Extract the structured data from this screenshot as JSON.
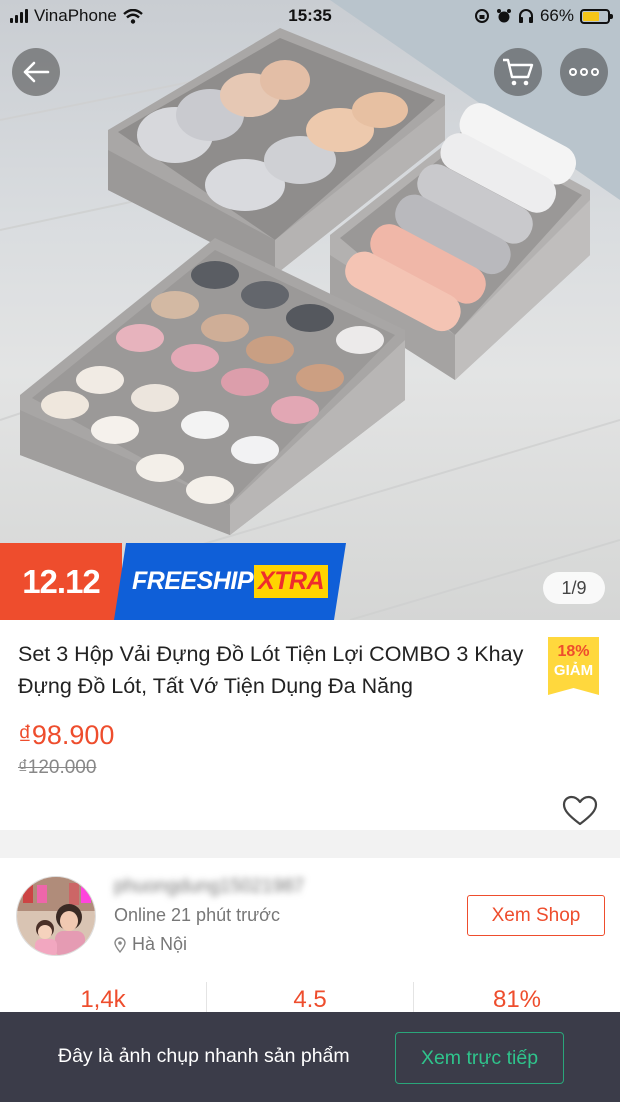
{
  "status_bar": {
    "carrier": "VinaPhone",
    "time": "15:35",
    "battery_percent": "66%",
    "battery_level": 0.66,
    "battery_color": "#f5c518",
    "icons": [
      "signal-icon",
      "wifi-icon",
      "rotation-lock-icon",
      "alarm-icon",
      "headphones-icon",
      "battery-icon"
    ]
  },
  "nav": {
    "back_icon": "arrow-left-icon",
    "cart_icon": "cart-icon",
    "more_icon": "more-dots-icon"
  },
  "gallery": {
    "counter": "1/9",
    "image_subject": "fabric underwear organizer boxes"
  },
  "promo": {
    "sale_label": "12.12",
    "freeship_label": "FREESHIP",
    "xtra_label": "XTRA",
    "colors": {
      "sale": "#ee4d2d",
      "freeship": "#0f5fd8",
      "xtra": "#ffd400"
    }
  },
  "product": {
    "title": "Set 3 Hộp Vải Đựng Đồ Lót Tiện Lợi COMBO 3 Khay Đựng Đồ Lót, Tất Vớ Tiện Dụng Đa Năng",
    "discount_percent": "18%",
    "discount_label": "GIẢM",
    "price": "₫98.900",
    "original_price": "₫120.000",
    "favorite_icon": "heart-outline-icon",
    "accent_color": "#ee4d2d"
  },
  "shop": {
    "name": "phuongdung15021987",
    "online_status": "Online 21 phút trước",
    "location": "Hà Nội",
    "location_icon": "location-pin-icon",
    "view_shop_label": "Xem Shop",
    "stats": [
      "1,4k",
      "4.5",
      "81%"
    ]
  },
  "snapshot_bar": {
    "message": "Đây là ảnh chụp nhanh sản phẩm",
    "live_button_label": "Xem trực tiếp",
    "button_color": "#2fc48c"
  }
}
